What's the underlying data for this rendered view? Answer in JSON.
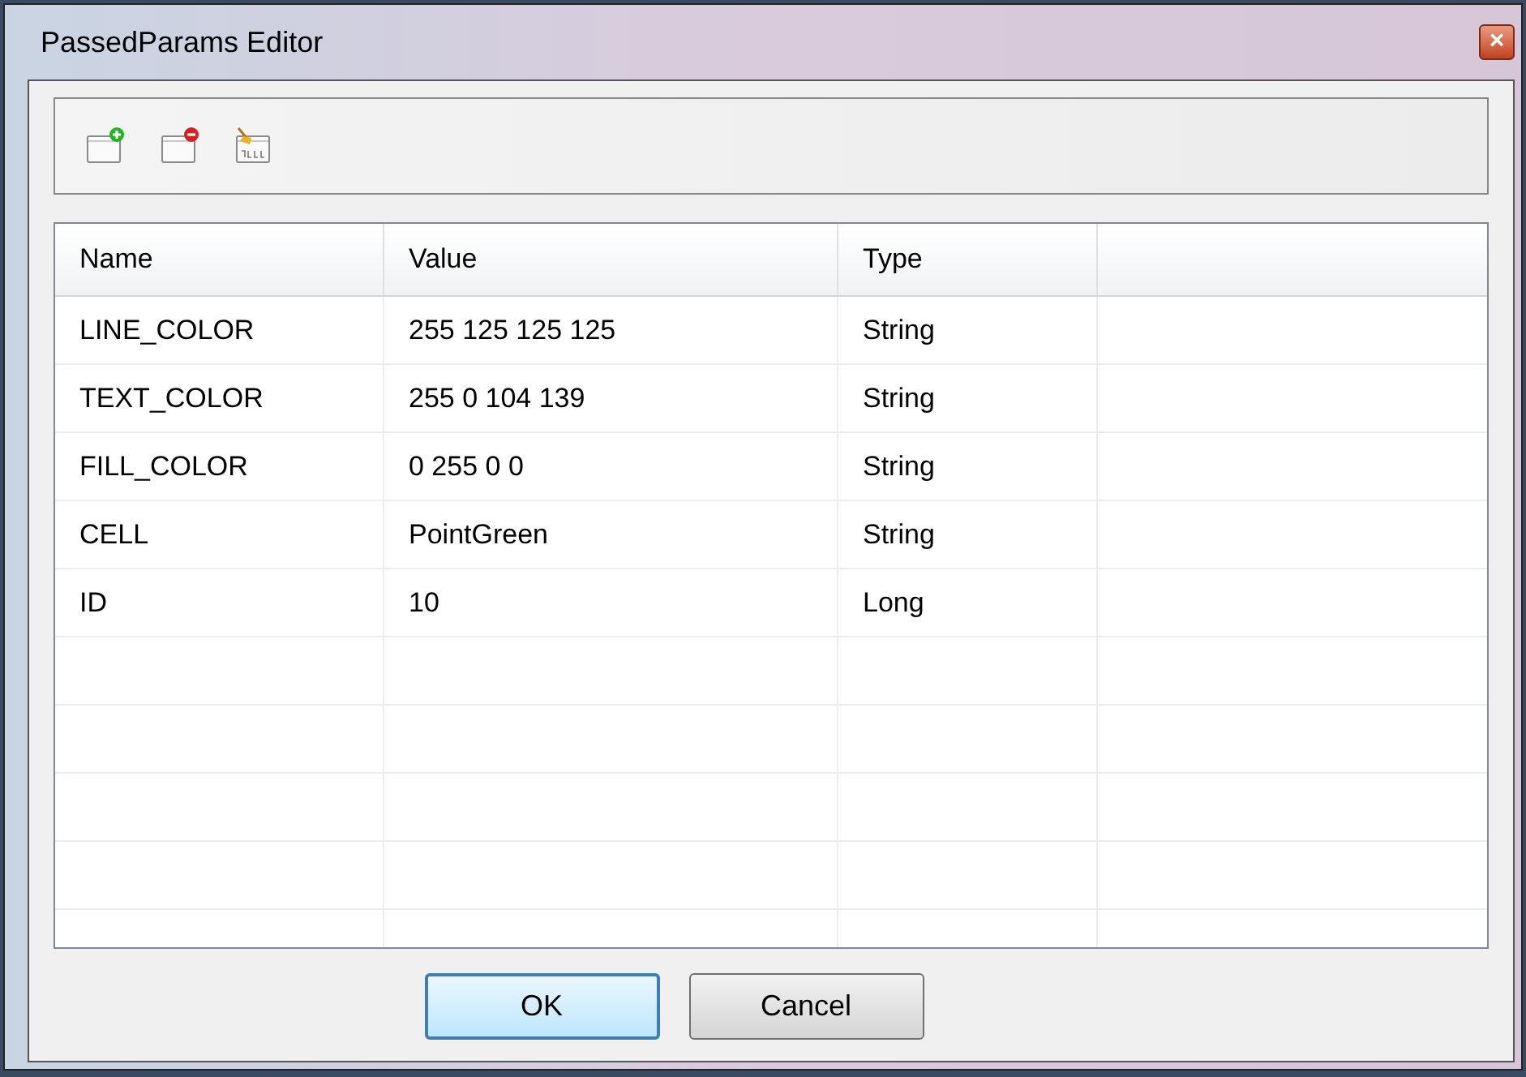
{
  "window": {
    "title": "PassedParams Editor",
    "close": "×"
  },
  "toolbar": {
    "buttons": [
      {
        "kind": "add"
      },
      {
        "kind": "remove"
      },
      {
        "kind": "null"
      }
    ]
  },
  "table": {
    "columns": [
      "Name",
      "Value",
      "Type"
    ],
    "rows": [
      {
        "name": "LINE_COLOR",
        "value": "255 125 125 125",
        "type": "String"
      },
      {
        "name": "TEXT_COLOR",
        "value": "255 0 104 139",
        "type": "String"
      },
      {
        "name": "FILL_COLOR",
        "value": "0 255 0 0",
        "type": "String"
      },
      {
        "name": "CELL",
        "value": "PointGreen",
        "type": "String"
      },
      {
        "name": "ID",
        "value": "10",
        "type": "Long"
      }
    ]
  },
  "buttons": [
    {
      "label": "OK",
      "selected": true
    },
    {
      "label": "Cancel",
      "selected": false
    }
  ]
}
